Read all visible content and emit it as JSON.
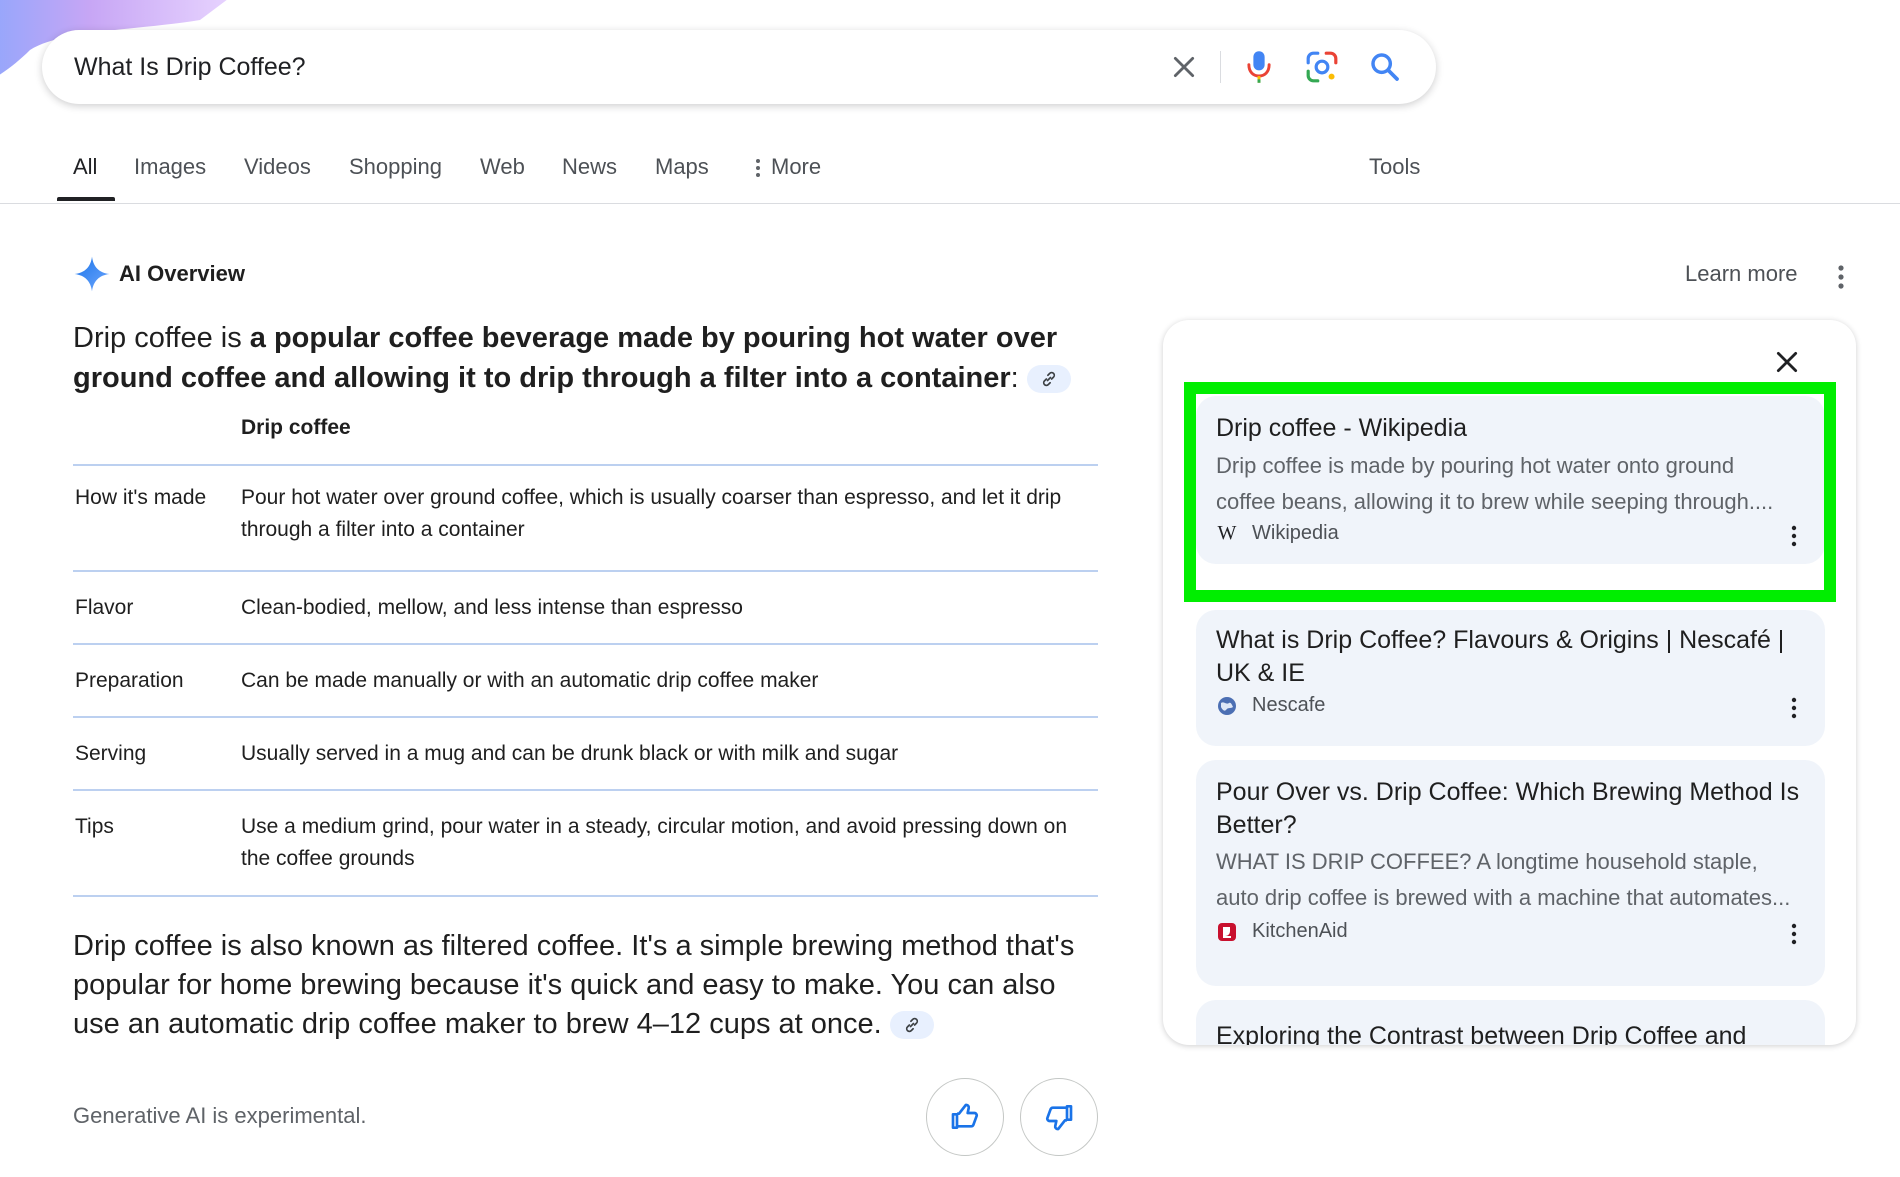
{
  "search": {
    "query": "What Is Drip Coffee?"
  },
  "tabs": [
    {
      "label": "All"
    },
    {
      "label": "Images"
    },
    {
      "label": "Videos"
    },
    {
      "label": "Shopping"
    },
    {
      "label": "Web"
    },
    {
      "label": "News"
    },
    {
      "label": "Maps"
    },
    {
      "label": "More"
    }
  ],
  "tools_label": "Tools",
  "ai_overview": {
    "title": "AI Overview",
    "learn_more": "Learn more",
    "lead_plain": "Drip coffee is ",
    "lead_bold": "a popular coffee beverage made by pouring hot water over ground coffee and allowing it to drip through a filter into a container",
    "lead_colon": ":",
    "table": {
      "header": "Drip coffee",
      "rows": [
        {
          "label": "How it's made",
          "value": "Pour hot water over ground coffee, which is usually coarser than espresso, and let it drip through a filter into a container"
        },
        {
          "label": "Flavor",
          "value": "Clean-bodied, mellow, and less intense than espresso"
        },
        {
          "label": "Preparation",
          "value": "Can be made manually or with an automatic drip coffee maker"
        },
        {
          "label": "Serving",
          "value": "Usually served in a mug and can be drunk black or with milk and sugar"
        },
        {
          "label": "Tips",
          "value": "Use a medium grind, pour water in a steady, circular motion, and avoid pressing down on the coffee grounds"
        }
      ]
    },
    "paragraph": "Drip coffee is also known as filtered coffee. It's a simple brewing method that's popular for home brewing because it's quick and easy to make. You can also use an automatic drip coffee maker to brew 4–12 cups at once.",
    "disclaimer": "Generative AI is experimental."
  },
  "sources": [
    {
      "title": "Drip coffee - Wikipedia",
      "snippet_line1": "Drip coffee is made by pouring hot water onto ground",
      "snippet_line2": "coffee beans, allowing it to brew while seeping through....",
      "site": "Wikipedia",
      "favicon_letter": "W"
    },
    {
      "title": "What is Drip Coffee? Flavours & Origins | Nescafé | UK & IE",
      "site": "Nescafe"
    },
    {
      "title": "Pour Over vs. Drip Coffee: Which Brewing Method Is Better?",
      "snippet_line1": "WHAT IS DRIP COFFEE? A longtime household staple,",
      "snippet_line2": "auto drip coffee is brewed with a machine that automates...",
      "site": "KitchenAid"
    },
    {
      "title": "Exploring the Contrast between Drip Coffee and"
    }
  ],
  "colors": {
    "highlight": "#00ee00",
    "card_bg": "#f0f4fa",
    "accent_blue": "#4285f4"
  }
}
